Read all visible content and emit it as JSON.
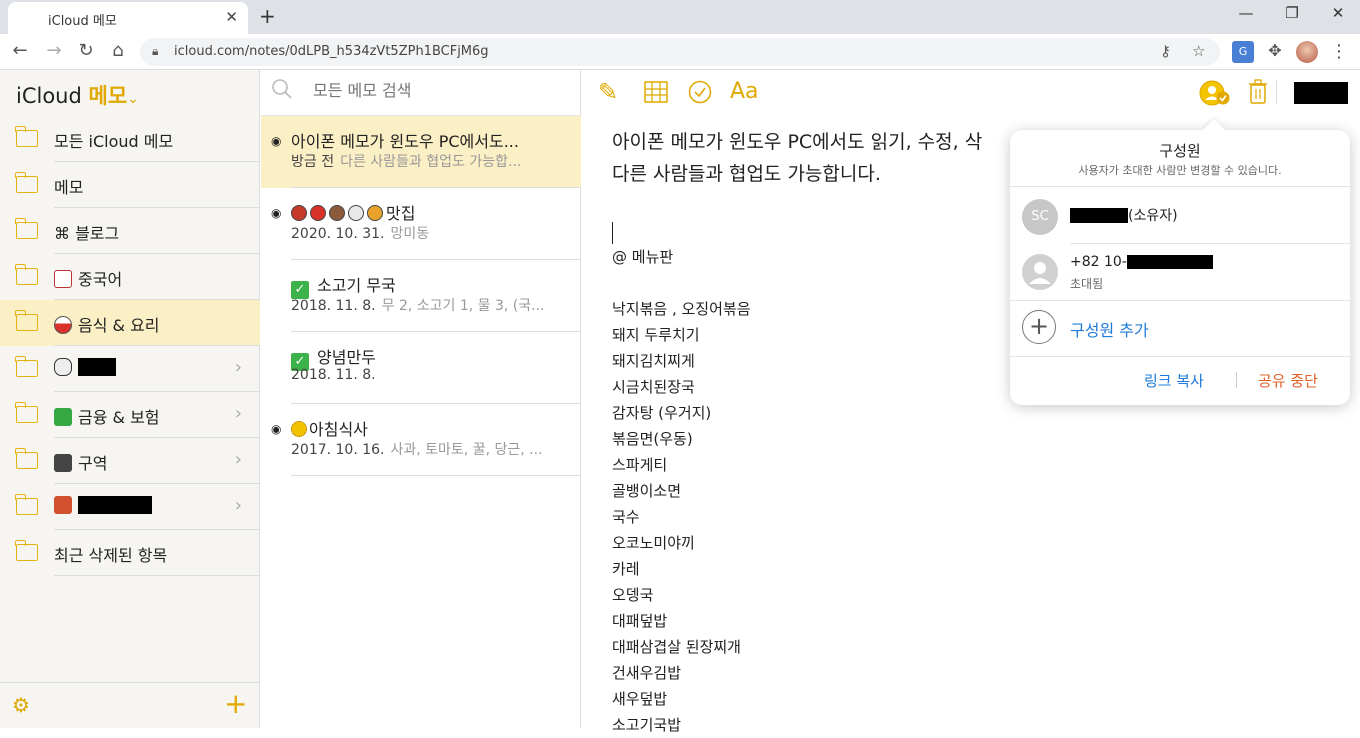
{
  "browser": {
    "tab_title": "iCloud 메모",
    "url": "icloud.com/notes/0dLPB_h534zVt5ZPh1BCFjM6g"
  },
  "app": {
    "brand_prefix": "iCloud",
    "brand_accent": "메모",
    "accent_color": "#e0a800"
  },
  "sidebar": {
    "folders": [
      {
        "label": "모든 iCloud 메모",
        "emoji": ""
      },
      {
        "label": "메모",
        "emoji": ""
      },
      {
        "label": "⌘ 블로그",
        "emoji": ""
      },
      {
        "label": "중국어",
        "emoji": "mahjong"
      },
      {
        "label": "음식 & 요리",
        "emoji": "bowl",
        "active": true
      },
      {
        "label": "",
        "emoji": "sheep",
        "redacted": true,
        "chevron": true
      },
      {
        "label": "금융 & 보험",
        "emoji": "chart",
        "chevron": true
      },
      {
        "label": "구역",
        "emoji": "laptop",
        "chevron": true
      },
      {
        "label": "",
        "emoji": "book",
        "redacted": true,
        "chevron": true
      },
      {
        "label": "최근 삭제된 항목",
        "emoji": ""
      }
    ]
  },
  "search": {
    "placeholder": "모든 메모 검색"
  },
  "notes": [
    {
      "title": "아이폰 메모가 윈도우 PC에서도...",
      "date": "방금 전",
      "preview": "다른 사람들과 협업도 가능합...",
      "pinned": true
    },
    {
      "title": "맛집",
      "date": "2020. 10. 31.",
      "preview": "망미동",
      "pinned": true
    },
    {
      "title": "소고기 무국",
      "date": "2018. 11. 8.",
      "preview": "무 2, 소고기 1, 물 3, (국...",
      "pinned": false
    },
    {
      "title": "양념만두",
      "date": "2018. 11. 8.",
      "preview": "",
      "pinned": false
    },
    {
      "title": "아침식사",
      "date": "2017. 10. 16.",
      "preview": "사과, 토마토, 꿀, 당근, ...",
      "pinned": true
    }
  ],
  "editor": {
    "heading_line1": "아이폰 메모가 윈도우 PC에서도 읽기, 수정, 삭",
    "heading_line2": "다른 사람들과 협업도 가능합니다.",
    "body": [
      "@ 메뉴판",
      "",
      "낙지볶음 , 오징어볶음",
      "돼지 두루치기",
      "돼지김치찌게",
      "시금치된장국",
      "감자탕 (우거지)",
      "볶음면(우동)",
      "스파게티",
      "골뱅이소면",
      "국수",
      "오코노미야끼",
      "카레",
      "오뎅국",
      "대패덮밥",
      "대패삼겹살 된장찌개",
      "건새우김밥",
      "새우덮밥",
      "소고기국밥"
    ]
  },
  "share": {
    "title": "구성원",
    "subtitle": "사용자가 초대한 사람만 변경할 수 있습니다.",
    "owner_initials": "SC",
    "owner_suffix": "(소유자)",
    "invitee_phone": "+82 10-",
    "invitee_status": "초대됨",
    "add_member": "구성원 추가",
    "copy_link": "링크 복사",
    "stop_sharing": "공유 중단"
  }
}
